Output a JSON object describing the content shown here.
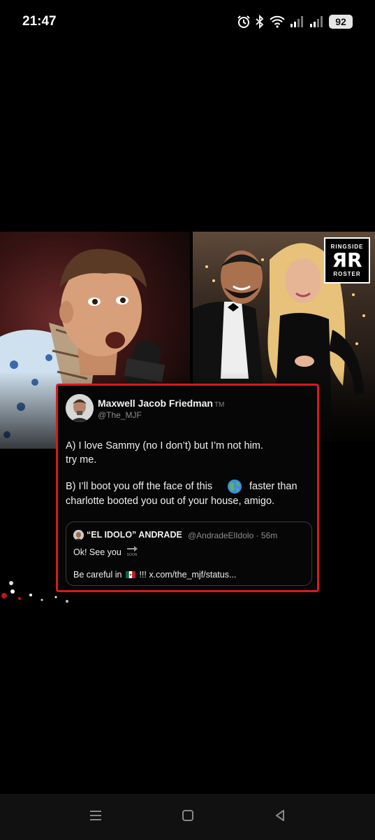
{
  "status_bar": {
    "time": "21:47",
    "battery": "92",
    "icons": [
      "alarm-icon",
      "bluetooth-icon",
      "wifi-icon",
      "signal-icon",
      "signal-icon",
      "battery-icon"
    ]
  },
  "post_image": {
    "logo": {
      "top": "RINGSIDE",
      "mark": "ЯR",
      "bottom": "ROSTER"
    },
    "tweet": {
      "author_name": "Maxwell Jacob Friedman",
      "trademark": "TM",
      "handle": "@The_MJF",
      "lines": [
        "A) I love Sammy (no I don’t) but I’m not him.",
        "try me.",
        "B) I’ll boot you off the face of this",
        "faster than",
        "charlotte booted you out of your house, amigo."
      ],
      "quote": {
        "name": "“EL IDOLO” ANDRADE",
        "meta": "@AndradeElIdolo · 56m",
        "line1": "Ok! See you",
        "line2_a": "Be careful in",
        "line2_b": "!!! x.com/the_mjf/status..."
      }
    }
  },
  "colors": {
    "card_border": "#d9191c",
    "background": "#000000",
    "nav_bar": "#111111"
  },
  "nav": {
    "buttons": [
      "menu-icon",
      "home-icon",
      "back-icon"
    ]
  }
}
